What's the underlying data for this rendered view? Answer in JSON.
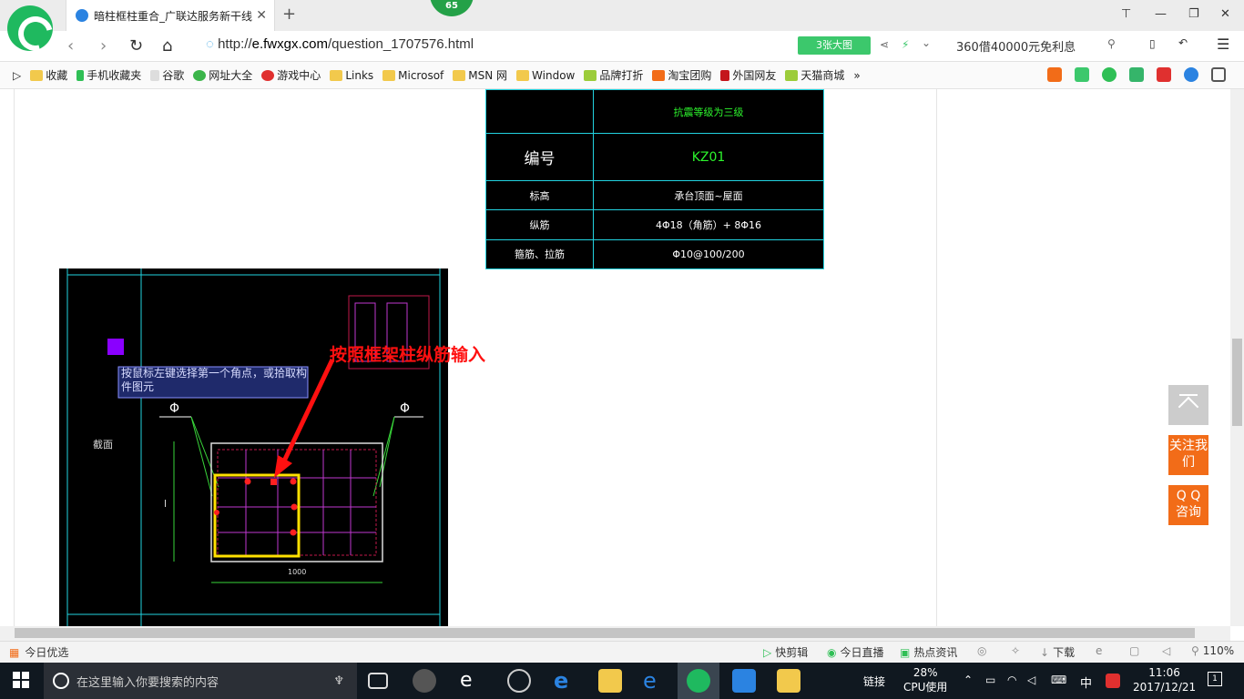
{
  "browser": {
    "tab_title": "暗柱框柱重合_广联达服务新干线",
    "badge": "65",
    "url_prefix": "http://",
    "url_host": "e.fwxgx.com",
    "url_path": "/question_1707576.html",
    "big_pic": "3张大图",
    "ad_text": "360借40000元免利息"
  },
  "bookmarks": [
    {
      "label": "收藏",
      "icon": "star-icon"
    },
    {
      "label": "手机收藏夹",
      "icon": "phone-icon"
    },
    {
      "label": "谷歌",
      "icon": "page-icon"
    },
    {
      "label": "网址大全",
      "icon": "globe-icon"
    },
    {
      "label": "游戏中心",
      "icon": "game-icon"
    },
    {
      "label": "Links",
      "icon": "folder-icon"
    },
    {
      "label": "Microsof",
      "icon": "folder-icon"
    },
    {
      "label": "MSN 网",
      "icon": "folder-icon"
    },
    {
      "label": "Window",
      "icon": "folder-icon"
    },
    {
      "label": "品牌打折",
      "icon": "leaf-icon"
    },
    {
      "label": "淘宝团购",
      "icon": "taobao-icon"
    },
    {
      "label": "外国网友",
      "icon": "flag-icon"
    },
    {
      "label": "天猫商城",
      "icon": "leaf-icon"
    }
  ],
  "cad_table": {
    "rows": [
      [
        "",
        "抗震等级为三级"
      ],
      [
        "编号",
        "KZ01"
      ],
      [
        "标高",
        "承台顶面~屋面"
      ],
      [
        "纵筋",
        "4Φ18（角筋）+ 8Φ16"
      ],
      [
        "箍筋、拉筋",
        "Φ10@100/200"
      ]
    ]
  },
  "cad": {
    "tooltip": "按鼠标左键选择第一个角点，或拾取构件图元",
    "section_label": "截面",
    "dim_width": "1000",
    "dim_left": "l",
    "phi_left": "Φ",
    "phi_right": "Φ"
  },
  "annotation": "按照框架柱纵筋输入",
  "float": {
    "follow": "关注我们",
    "qq": "Q Q 咨询"
  },
  "statusbar": {
    "left": "今日优选",
    "items": [
      "快剪辑",
      "今日直播",
      "热点资讯"
    ],
    "download": "下载",
    "zoom": "110%"
  },
  "taskbar": {
    "search_placeholder": "在这里输入你要搜索的内容",
    "link": "链接",
    "cpu_percent": "28%",
    "cpu_label": "CPU使用",
    "ime": "中",
    "time": "11:06",
    "date": "2017/12/21",
    "notifications": "1"
  }
}
